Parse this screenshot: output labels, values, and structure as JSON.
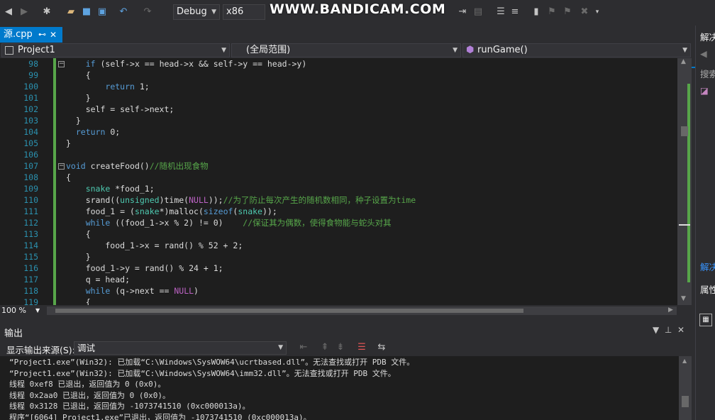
{
  "toolbar": {
    "config": "Debug",
    "platform": "x86",
    "watermark": "WWW.BANDICAM.COM",
    "icons": [
      "back-icon",
      "forward-icon",
      "new-project-icon",
      "open-folder-icon",
      "save-icon",
      "save-all-icon",
      "undo-icon",
      "redo-icon",
      "step-icon",
      "indent-icon",
      "outdent-icon",
      "comment-icon",
      "uncomment-icon",
      "bookmark-icon",
      "prev-bookmark-icon",
      "next-bookmark-icon",
      "clear-bookmarks-icon"
    ]
  },
  "tab": {
    "label": "源.cpp",
    "pin": "⊷",
    "close": "✕"
  },
  "nav": {
    "project": "Project1",
    "scope": "(全局范围)",
    "function": "runGame()"
  },
  "editor": {
    "lines": [
      {
        "n": "98",
        "code": "    if (self->x == head->x && self->y == head->y)"
      },
      {
        "n": "99",
        "code": "    {"
      },
      {
        "n": "100",
        "code": "        return 1;"
      },
      {
        "n": "101",
        "code": "    }"
      },
      {
        "n": "102",
        "code": "    self = self->next;"
      },
      {
        "n": "103",
        "code": "  }"
      },
      {
        "n": "104",
        "code": "  return 0;"
      },
      {
        "n": "105",
        "code": "}"
      },
      {
        "n": "106",
        "code": ""
      },
      {
        "n": "107",
        "code": "void createFood()//随机出现食物"
      },
      {
        "n": "108",
        "code": "{"
      },
      {
        "n": "109",
        "code": "    snake *food_1;"
      },
      {
        "n": "110",
        "code": "    srand((unsigned)time(NULL));//为了防止每次产生的随机数相同，种子设置为time"
      },
      {
        "n": "111",
        "code": "    food_1 = (snake*)malloc(sizeof(snake));"
      },
      {
        "n": "112",
        "code": "    while ((food_1->x % 2) != 0)    //保证其为偶数，使得食物能与蛇头对其"
      },
      {
        "n": "113",
        "code": "    {"
      },
      {
        "n": "114",
        "code": "        food_1->x = rand() % 52 + 2;"
      },
      {
        "n": "115",
        "code": "    }"
      },
      {
        "n": "116",
        "code": "    food_1->y = rand() % 24 + 1;"
      },
      {
        "n": "117",
        "code": "    q = head;"
      },
      {
        "n": "118",
        "code": "    while (q->next == NULL)"
      },
      {
        "n": "119",
        "code": "    {"
      }
    ],
    "zoom": "100 %"
  },
  "output": {
    "title": "输出",
    "source_label": "显示输出来源(S):",
    "source_value": "调试",
    "lines": [
      "“Project1.exe”(Win32): 已加载“C:\\Windows\\SysWOW64\\ucrtbased.dll”。无法查找或打开 PDB 文件。",
      "“Project1.exe”(Win32): 已加载“C:\\Windows\\SysWOW64\\imm32.dll”。无法查找或打开 PDB 文件。",
      "线程 0xef8 已退出，返回值为 0 (0x0)。",
      "线程 0x2aa0 已退出，返回值为 0 (0x0)。",
      "线程 0x3128 已退出，返回值为 -1073741510 (0xc000013a)。",
      "程序“[6064] Project1.exe”已退出，返回值为 -1073741510 (0xc000013a)。"
    ]
  },
  "right_panel": {
    "solution": "解决",
    "search": "搜索",
    "solution2": "解决",
    "properties": "属性"
  }
}
